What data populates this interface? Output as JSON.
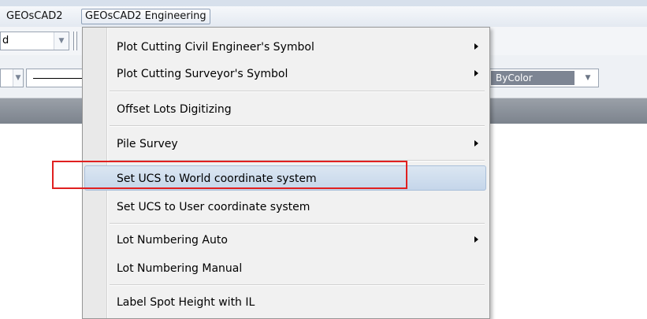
{
  "menubar": {
    "items": [
      {
        "label": "GEOsCAD2"
      },
      {
        "label": "GEOsCAD2 Engineering"
      }
    ]
  },
  "toolbar": {
    "combo1_value": "d",
    "color_combo_value": "ByColor"
  },
  "dropdown": {
    "items": [
      {
        "label": "Plot Cutting Civil Engineer's Symbol",
        "has_submenu": true
      },
      {
        "label": "Plot Cutting Surveyor's Symbol",
        "has_submenu": true
      },
      {
        "label": "Offset Lots Digitizing",
        "has_submenu": false
      },
      {
        "label": "Pile Survey",
        "has_submenu": true
      },
      {
        "label": "Set UCS to World coordinate system",
        "has_submenu": false,
        "highlighted": true
      },
      {
        "label": "Set UCS to User coordinate system",
        "has_submenu": false
      },
      {
        "label": "Lot Numbering Auto",
        "has_submenu": true
      },
      {
        "label": "Lot Numbering Manual",
        "has_submenu": false
      },
      {
        "label": "Label Spot Height with IL",
        "has_submenu": false
      }
    ]
  },
  "colors": {
    "highlight": "#c5d6ea",
    "annotation_box": "#e02020"
  }
}
